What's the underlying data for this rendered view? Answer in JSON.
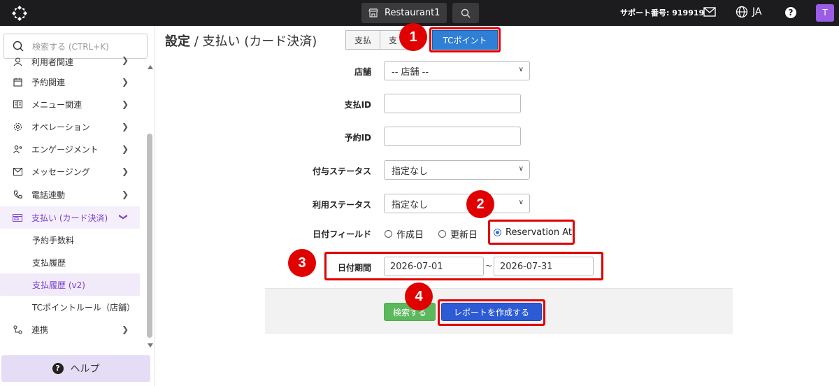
{
  "topbar": {
    "store_label": "Restaurant1",
    "support_label": "サポート番号: 919919",
    "language": "JA",
    "avatar_initial": "T"
  },
  "sidebar": {
    "search_placeholder": "検索する (CTRL+K)",
    "items": [
      {
        "label": "利用者関連",
        "icon": "user-icon"
      },
      {
        "label": "予約関連",
        "icon": "calendar-icon"
      },
      {
        "label": "メニュー関連",
        "icon": "menu-book-icon"
      },
      {
        "label": "オペレーション",
        "icon": "settings-gear-icon"
      },
      {
        "label": "エンゲージメント",
        "icon": "engagement-icon"
      },
      {
        "label": "メッセージング",
        "icon": "mail-icon"
      },
      {
        "label": "電話連動",
        "icon": "phone-icon"
      },
      {
        "label": "支払い (カード決済)",
        "icon": "payment-card-icon"
      }
    ],
    "subitems": [
      "予約手数料",
      "支払履歴",
      "支払履歴 (v2)",
      "TCポイントルール（店舗）"
    ],
    "after_items": [
      {
        "label": "連携",
        "icon": "integration-icon"
      }
    ],
    "help_label": "ヘルプ"
  },
  "main": {
    "title_strong": "設定",
    "title_rest": " / 支払い (カード決済)",
    "tabs": [
      "支払",
      "支",
      "TCポイント"
    ],
    "form": {
      "store_label": "店舗",
      "store_value": "-- 店舗 --",
      "payment_id_label": "支払ID",
      "payment_id_value": "",
      "reservation_id_label": "予約ID",
      "reservation_id_value": "",
      "grant_status_label": "付与ステータス",
      "grant_status_value": "指定なし",
      "use_status_label": "利用ステータス",
      "use_status_value": "指定なし",
      "date_field_label": "日付フィールド",
      "date_options": [
        "作成日",
        "更新日",
        "Reservation At"
      ],
      "date_selected": "Reservation At",
      "period_label": "日付期間",
      "period_from": "2026-07-01",
      "period_separator": "~",
      "period_to": "2026-07-31"
    },
    "buttons": {
      "search": "検索する",
      "report": "レポートを作成する"
    }
  },
  "annotations": [
    "1",
    "2",
    "3",
    "4"
  ],
  "colors": {
    "accent_purple": "#7b3fd0",
    "tab_active": "#2f7fd6",
    "annotation_red": "#e00000",
    "search_green": "#5cb85c",
    "report_blue": "#2d5bd6"
  }
}
